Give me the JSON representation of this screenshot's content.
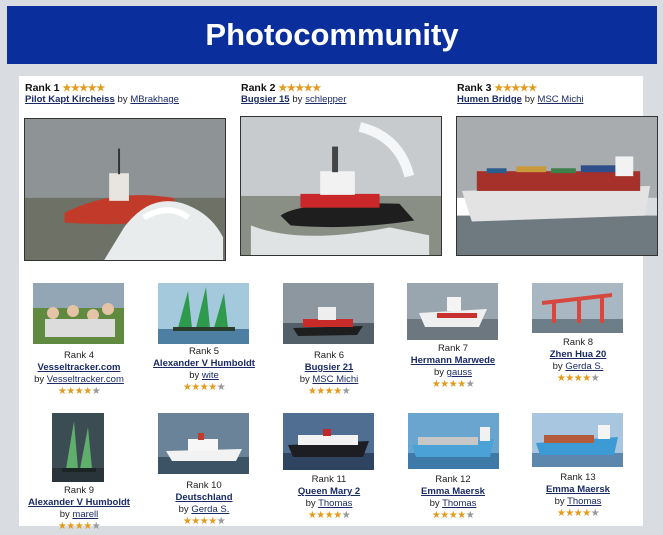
{
  "header": {
    "title": "Photocommunity"
  },
  "top": [
    {
      "rank": "Rank 1",
      "title": "Pilot Kapt Kircheiss",
      "by": "by",
      "user": "MBrakhage",
      "stars": 5
    },
    {
      "rank": "Rank 2",
      "title": "Bugsier 15",
      "by": "by",
      "user": "schlepper",
      "stars": 5
    },
    {
      "rank": "Rank 3",
      "title": "Humen Bridge",
      "by": "by",
      "user": "MSC Michi",
      "stars": 5
    }
  ],
  "grid": [
    {
      "rank": "Rank 4",
      "title": "Vesseltracker.com",
      "by": "by",
      "user": "Vesseltracker.com",
      "stars": 4
    },
    {
      "rank": "Rank 5",
      "title": "Alexander V Humboldt",
      "by": "by",
      "user": "wite",
      "stars": 4
    },
    {
      "rank": "Rank 6",
      "title": "Bugsier 21",
      "by": "by",
      "user": "MSC Michi",
      "stars": 4
    },
    {
      "rank": "Rank 7",
      "title": "Hermann Marwede",
      "by": "by",
      "user": "gauss",
      "stars": 4
    },
    {
      "rank": "Rank 8",
      "title": "Zhen Hua 20",
      "by": "by",
      "user": "Gerda S.",
      "stars": 4
    },
    {
      "rank": "Rank 9",
      "title": "Alexander V Humboldt",
      "by": "by",
      "user": "marell",
      "stars": 4
    },
    {
      "rank": "Rank 10",
      "title": "Deutschland",
      "by": "by",
      "user": "Gerda S.",
      "stars": 4
    },
    {
      "rank": "Rank 11",
      "title": "Queen Mary 2",
      "by": "by",
      "user": "Thomas",
      "stars": 4
    },
    {
      "rank": "Rank 12",
      "title": "Emma Maersk",
      "by": "by",
      "user": "Thomas",
      "stars": 4
    },
    {
      "rank": "Rank 13",
      "title": "Emma Maersk",
      "by": "by",
      "user": "Thomas",
      "stars": 4
    }
  ],
  "colors": {
    "banner": "#0a2f9d",
    "star_on": "#e39b1e",
    "star_off": "#999999",
    "link": "#1a2a66"
  }
}
